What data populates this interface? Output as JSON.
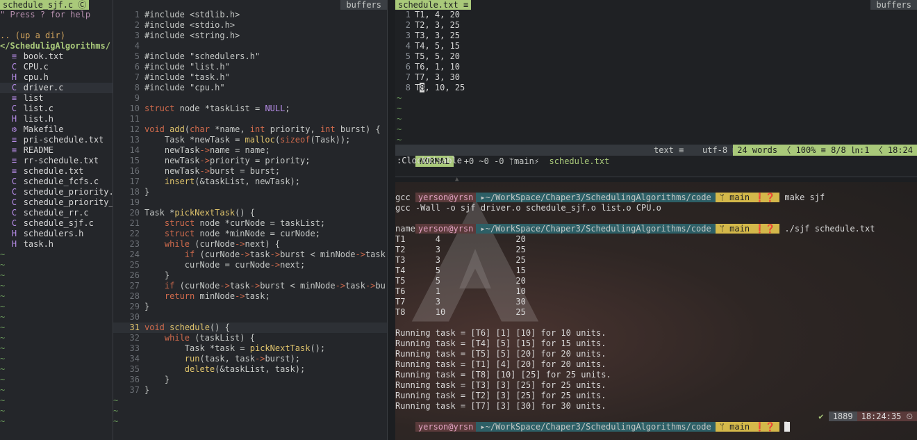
{
  "tree": {
    "tab_label": "schedule_sjf.c",
    "buffers_label": "buffers",
    "help": "\" Press ? for help",
    "up": ".. (up a dir)",
    "root": "</ScheduligAlgorithms/",
    "files": [
      {
        "name": "book.txt",
        "icon": "text-file-icon",
        "glyph": "≡"
      },
      {
        "name": "CPU.c",
        "icon": "c-file-icon",
        "glyph": "C"
      },
      {
        "name": "cpu.h",
        "icon": "h-file-icon",
        "glyph": "H"
      },
      {
        "name": "driver.c",
        "icon": "c-file-icon",
        "glyph": "C"
      },
      {
        "name": "list",
        "icon": "text-file-icon",
        "glyph": "≡"
      },
      {
        "name": "list.c",
        "icon": "c-file-icon",
        "glyph": "C"
      },
      {
        "name": "list.h",
        "icon": "h-file-icon",
        "glyph": "H"
      },
      {
        "name": "Makefile",
        "icon": "gear-icon",
        "glyph": "⚙"
      },
      {
        "name": "pri-schedule.txt",
        "icon": "text-file-icon",
        "glyph": "≡"
      },
      {
        "name": "README",
        "icon": "text-file-icon",
        "glyph": "≡"
      },
      {
        "name": "rr-schedule.txt",
        "icon": "text-file-icon",
        "glyph": "≡"
      },
      {
        "name": "schedule.txt",
        "icon": "text-file-icon",
        "glyph": "≡"
      },
      {
        "name": "schedule_fcfs.c",
        "icon": "c-file-icon",
        "glyph": "C"
      },
      {
        "name": "schedule_priority.",
        "icon": "c-file-icon",
        "glyph": "C"
      },
      {
        "name": "schedule_priority_",
        "icon": "c-file-icon",
        "glyph": "C"
      },
      {
        "name": "schedule_rr.c",
        "icon": "c-file-icon",
        "glyph": "C"
      },
      {
        "name": "schedule_sjf.c",
        "icon": "c-file-icon",
        "glyph": "C"
      },
      {
        "name": "schedulers.h",
        "icon": "h-file-icon",
        "glyph": "H"
      },
      {
        "name": "task.h",
        "icon": "h-file-icon",
        "glyph": "H"
      }
    ],
    "tilde": "~"
  },
  "code": {
    "lines": [
      {
        "n": "1",
        "t": "#include <stdlib.h>"
      },
      {
        "n": "2",
        "t": "#include <stdio.h>"
      },
      {
        "n": "3",
        "t": "#include <string.h>"
      },
      {
        "n": "4",
        "t": ""
      },
      {
        "n": "5",
        "t": "#include \"schedulers.h\""
      },
      {
        "n": "6",
        "t": "#include \"list.h\""
      },
      {
        "n": "7",
        "t": "#include \"task.h\""
      },
      {
        "n": "8",
        "t": "#include \"cpu.h\""
      },
      {
        "n": "9",
        "t": ""
      },
      {
        "n": "10",
        "t": "struct node *taskList = NULL;"
      },
      {
        "n": "11",
        "t": ""
      },
      {
        "n": "12",
        "t": "void add(char *name, int priority, int burst) {"
      },
      {
        "n": "13",
        "t": "    Task *newTask = malloc(sizeof(Task));"
      },
      {
        "n": "14",
        "t": "    newTask->name = name;"
      },
      {
        "n": "15",
        "t": "    newTask->priority = priority;"
      },
      {
        "n": "16",
        "t": "    newTask->burst = burst;"
      },
      {
        "n": "17",
        "t": "    insert(&taskList, newTask);"
      },
      {
        "n": "18",
        "t": "}"
      },
      {
        "n": "19",
        "t": ""
      },
      {
        "n": "20",
        "t": "Task *pickNextTask() {"
      },
      {
        "n": "21",
        "t": "    struct node *curNode = taskList;"
      },
      {
        "n": "22",
        "t": "    struct node *minNode = curNode;"
      },
      {
        "n": "23",
        "t": "    while (curNode->next) {"
      },
      {
        "n": "24",
        "t": "        if (curNode->task->burst < minNode->task->"
      },
      {
        "n": "25",
        "t": "        curNode = curNode->next;"
      },
      {
        "n": "26",
        "t": "    }"
      },
      {
        "n": "27",
        "t": "    if (curNode->task->burst < minNode->task->burs"
      },
      {
        "n": "28",
        "t": "    return minNode->task;"
      },
      {
        "n": "29",
        "t": "}"
      },
      {
        "n": "30",
        "t": ""
      },
      {
        "n": "31",
        "t": "void schedule() {"
      },
      {
        "n": "32",
        "t": "    while (taskList) {"
      },
      {
        "n": "33",
        "t": "        Task *task = pickNextTask();"
      },
      {
        "n": "34",
        "t": "        run(task, task->burst);"
      },
      {
        "n": "35",
        "t": "        delete(&taskList, task);"
      },
      {
        "n": "36",
        "t": "    }"
      },
      {
        "n": "37",
        "t": "}"
      }
    ],
    "tilde": "~"
  },
  "sched": {
    "tab_label": "schedule.txt",
    "buffers_label": "buffers",
    "lines": [
      {
        "n": "1",
        "t": "T1, 4, 20"
      },
      {
        "n": "2",
        "t": "T2, 3, 25"
      },
      {
        "n": "3",
        "t": "T3, 3, 25"
      },
      {
        "n": "4",
        "t": "T4, 5, 15"
      },
      {
        "n": "5",
        "t": "T5, 5, 20"
      },
      {
        "n": "6",
        "t": "T6, 1, 10"
      },
      {
        "n": "7",
        "t": "T7, 3, 30"
      },
      {
        "n": "8",
        "t": "T8, 10, 25"
      }
    ],
    "status": {
      "mode": "NORMAL",
      "diff": "+0 ~0 -0",
      "branch": "main⚡",
      "file": "schedule.txt",
      "ftype": "text ≡",
      "enc": "utf-8 ⊞",
      "right": "24 words 〈 100% ≡ 8/8 ㏑:1 〈 18:24"
    },
    "cmdline": ":ClockDisable"
  },
  "terminal": {
    "user": "yerson@yrsn",
    "path": "▸~/WorkSpace/Chaper3/SchedulingAlgorithms/code",
    "git": "ᛘ main ❗❓",
    "cmd1": "make sjf",
    "out1": [
      "gcc -Wall -c schedule_sjf.c",
      "gcc -Wall -o sjf driver.o schedule_sjf.o list.o CPU.o"
    ],
    "cmd2": "./sjf schedule.txt",
    "table_header": "name    priority        burst",
    "table_rows": [
      "T1      4               20",
      "T2      3               25",
      "T3      3               25",
      "T4      5               15",
      "T5      5               20",
      "T6      1               10",
      "T7      3               30",
      "T8      10              25"
    ],
    "running": [
      "Running task = [T6] [1] [10] for 10 units.",
      "Running task = [T4] [5] [15] for 15 units.",
      "Running task = [T5] [5] [20] for 20 units.",
      "Running task = [T1] [4] [20] for 20 units.",
      "Running task = [T8] [10] [25] for 25 units.",
      "Running task = [T3] [3] [25] for 25 units.",
      "Running task = [T2] [3] [25] for 25 units.",
      "Running task = [T7] [3] [30] for 30 units."
    ],
    "ok_mark": "✔",
    "hist": "1889",
    "clock": "18:24:35 ⏲"
  }
}
